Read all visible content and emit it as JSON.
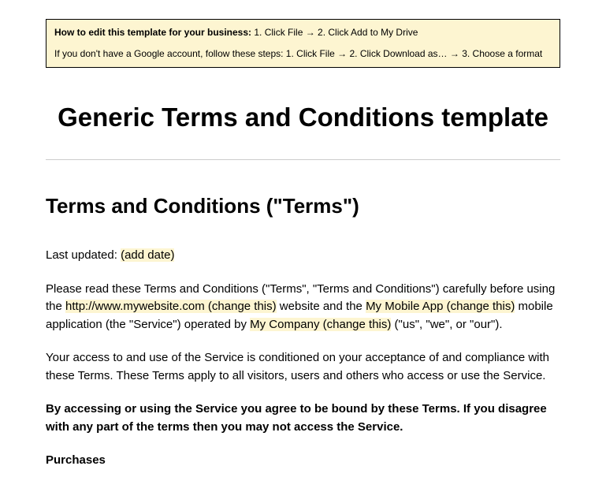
{
  "notice": {
    "line1_bold": "How to edit this template for your business:",
    "line1_rest": " 1. Click File → 2. Click Add to My Drive",
    "line2": "If you don't have a Google account, follow these steps: 1. Click File → 2. Click Download as… → 3. Choose a format"
  },
  "title": "Generic Terms and Conditions template",
  "subtitle": "Terms and Conditions (\"Terms\")",
  "last_updated_prefix": "Last updated: ",
  "last_updated_placeholder": "(add date)",
  "para1": {
    "t1": "Please read these Terms and Conditions (\"Terms\", \"Terms and Conditions\") carefully before using the ",
    "hl1": "http://www.mywebsite.com (change this)",
    "t2": " website and the ",
    "hl2": "My Mobile App (change this)",
    "t3": " mobile application (the \"Service\") operated by ",
    "hl3": "My Company (change this)",
    "t4": " (\"us\", \"we\", or \"our\")."
  },
  "para2": "Your access to and use of the Service is conditioned on your acceptance of and compliance with these Terms. These Terms apply to all visitors, users and others who access or use the Service.",
  "para3": "By accessing or using the Service you agree to be bound by these Terms. If you disagree with any part of the terms then you may not access the Service.",
  "section1": "Purchases"
}
